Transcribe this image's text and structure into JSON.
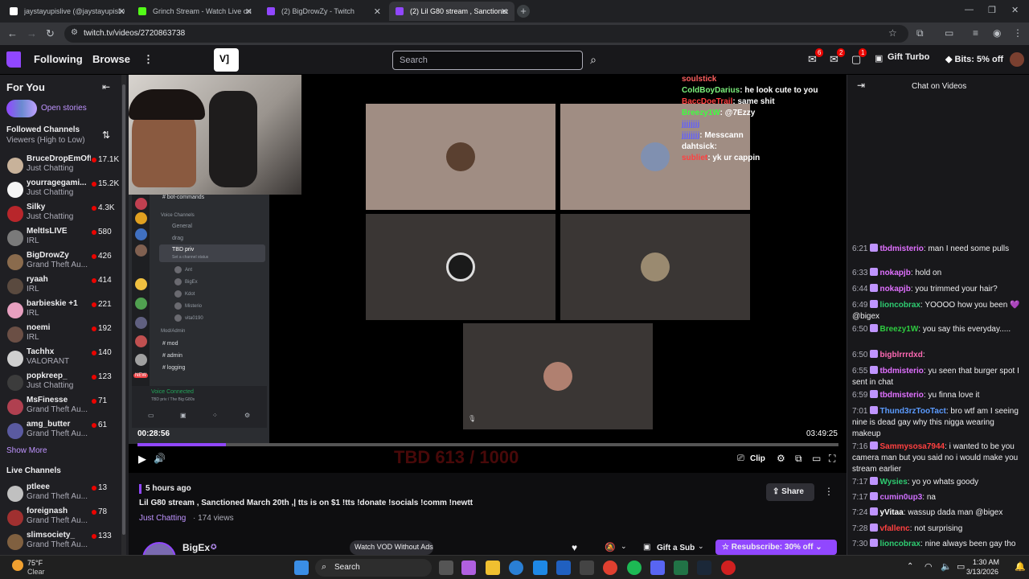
{
  "browser": {
    "tabs": [
      {
        "title": "jaystayupislive (@jaystayupislive)",
        "color": "#ffffff"
      },
      {
        "title": "Grinch Stream - Watch Live on",
        "color": "#53fc18"
      },
      {
        "title": "(2) BigDrowZy - Twitch",
        "color": "#9147ff"
      },
      {
        "title": "(2) Lil G80 stream , Sanctioned",
        "color": "#9147ff"
      }
    ],
    "url": "twitch.tv/videos/2720863738"
  },
  "topnav": {
    "following": "Following",
    "browse": "Browse",
    "search_placeholder": "Search",
    "badges": [
      "6",
      "2",
      "1"
    ],
    "gift_turbo": "Gift Turbo",
    "bits": "Bits: 5% off"
  },
  "sidebar": {
    "for_you": "For You",
    "open_stories": "Open stories",
    "followed_title": "Followed Channels",
    "followed_sort": "Viewers (High to Low)",
    "channels": [
      {
        "name": "BruceDropEmOff",
        "category": "Just Chatting",
        "viewers": "17.1K",
        "color": "#c8b29a"
      },
      {
        "name": "yourragegami...",
        "category": "Just Chatting",
        "viewers": "15.2K",
        "color": "#f5f5f5"
      },
      {
        "name": "Silky",
        "category": "Just Chatting",
        "viewers": "4.3K",
        "color": "#b8262b"
      },
      {
        "name": "MeltIsLIVE",
        "category": "IRL",
        "viewers": "580",
        "color": "#7a7a7a"
      },
      {
        "name": "BigDrowZy",
        "category": "Grand Theft Au...",
        "viewers": "426",
        "color": "#8a6b4d"
      },
      {
        "name": "ryaah",
        "category": "IRL",
        "viewers": "414",
        "color": "#5a4a3f"
      },
      {
        "name": "barbieskie +1",
        "category": "IRL",
        "viewers": "221",
        "color": "#e8a0c0"
      },
      {
        "name": "noemi",
        "category": "IRL",
        "viewers": "192",
        "color": "#6b4f45"
      },
      {
        "name": "Tachhx",
        "category": "VALORANT",
        "viewers": "140",
        "color": "#d0d0d0"
      },
      {
        "name": "popkreep_",
        "category": "Just Chatting",
        "viewers": "123",
        "color": "#3c3c3c"
      },
      {
        "name": "MsFinesse",
        "category": "Grand Theft Au...",
        "viewers": "71",
        "color": "#b04050"
      },
      {
        "name": "amg_butter",
        "category": "Grand Theft Au...",
        "viewers": "61",
        "color": "#5a5aa0"
      }
    ],
    "show_more": "Show More",
    "live_title": "Live Channels",
    "live": [
      {
        "name": "ptleee",
        "category": "Grand Theft Au...",
        "viewers": "13",
        "color": "#c0c0c0"
      },
      {
        "name": "foreignash",
        "category": "Grand Theft Au...",
        "viewers": "78",
        "color": "#a03030"
      },
      {
        "name": "slimsociety_",
        "category": "Grand Theft Au...",
        "viewers": "133",
        "color": "#806040"
      }
    ]
  },
  "player": {
    "current_time": "00:28:56",
    "duration": "03:49:25",
    "progress": 0.126,
    "clip": "Clip",
    "discord": {
      "bot_commands": "bot-commands",
      "voice_channels": "Voice Channels",
      "general": "General",
      "drag": "drag",
      "tbd_priv": "TBD priv",
      "status": "Set a channel status",
      "members": [
        "Ant",
        "BigEx",
        "Kdot",
        "Misterio",
        "vita0190"
      ],
      "mod_admin": "Mod/Admin",
      "mod": "mod",
      "admin": "admin",
      "logging": "logging",
      "voice_connected": "Voice Connected",
      "voice_sub": "TBD priv / The Big G80s",
      "new": "NEW"
    },
    "overlay_chat": [
      {
        "user": "soulstick",
        "text": "",
        "color": "#ff6060"
      },
      {
        "user": "ColdBoyDarius",
        "text": ": he look cute to you",
        "color": "#7cf07c"
      },
      {
        "user": "BaccDoeTrail",
        "text": ": same shit",
        "color": "#ff4040"
      },
      {
        "user": "Breezy1W",
        "text": ": @7Ezzy",
        "color": "#40ff40"
      },
      {
        "user": "jjjjjjjj",
        "text": "",
        "color": "#6060ff"
      },
      {
        "user": "jjjjjjjj",
        "text": ": Messcann",
        "color": "#6060ff"
      },
      {
        "user": "dahtsick",
        "text": ":",
        "color": "#ffffff"
      },
      {
        "user": "subliet",
        "text": ": yk ur cappin",
        "color": "#ff4040"
      }
    ],
    "watermark": "TBD 613 / 1000"
  },
  "video_info": {
    "age": "5 hours ago",
    "title": "Lil G80 stream , Sanctioned March 20th ,| tts is on $1 !tts !donate !socials !comm !newtt",
    "category": "Just Chatting",
    "views": "· 174 views",
    "share": "Share",
    "streamer": "BigEx",
    "watch_vod": "Watch VOD Without Ads",
    "gift_sub": "Gift a Sub",
    "resubscribe": "Resubscribe: 30% off"
  },
  "chat": {
    "title": "Chat on Videos",
    "messages": [
      {
        "time": "6:21",
        "user": "tbdmisterio",
        "color": "#e070ff",
        "text": ": man I need some pulls"
      },
      {
        "time": "6:33",
        "user": "nokapjb",
        "color": "#e070ff",
        "text": ": hold on"
      },
      {
        "time": "6:44",
        "user": "nokapjb",
        "color": "#e070ff",
        "text": ": you trimmed your hair?"
      },
      {
        "time": "6:49",
        "user": "lioncobrax",
        "color": "#2ecc71",
        "text": ": YOOOO how you been 💜 @bigex"
      },
      {
        "time": "6:50",
        "user": "Breezy1W",
        "color": "#2ecc40",
        "text": ": you say this everyday....."
      },
      {
        "time": "6:50",
        "user": "bigblrrrdxd",
        "color": "#ff69b4",
        "text": ":"
      },
      {
        "time": "6:55",
        "user": "tbdmisterio",
        "color": "#e070ff",
        "text": ": yu seen that burger spot I sent in chat"
      },
      {
        "time": "6:59",
        "user": "tbdmisterio",
        "color": "#e070ff",
        "text": ": yu finna love it"
      },
      {
        "time": "7:01",
        "user": "Thund3rzTooTact",
        "color": "#5b9bff",
        "text": ": bro wtf am I seeing nine is dead gay why this nigga wearing makeup"
      },
      {
        "time": "7:16",
        "user": "Sammysosa7944",
        "color": "#ff4040",
        "text": ": i wanted to be you camera man but you said no i would make you stream earlier"
      },
      {
        "time": "7:17",
        "user": "Wysies",
        "color": "#2ecc71",
        "text": ": yo yo whats goody"
      },
      {
        "time": "7:17",
        "user": "cumin0up3",
        "color": "#d070ff",
        "text": ": na"
      },
      {
        "time": "7:24",
        "user": "yVitaa",
        "color": "#ffffff",
        "text": ": wassup dada man @bigex"
      },
      {
        "time": "7:28",
        "user": "vfallenc",
        "color": "#ff4040",
        "text": ": not surprising"
      },
      {
        "time": "7:30",
        "user": "lioncobrax",
        "color": "#2ecc71",
        "text": ": nine always been gay tho"
      }
    ]
  },
  "taskbar": {
    "temp": "75°F",
    "weather": "Clear",
    "search": "Search",
    "time": "1:30 AM",
    "date": "3/13/2026"
  },
  "colors": {
    "twitch_purple": "#9147ff",
    "live_red": "#eb0400"
  }
}
